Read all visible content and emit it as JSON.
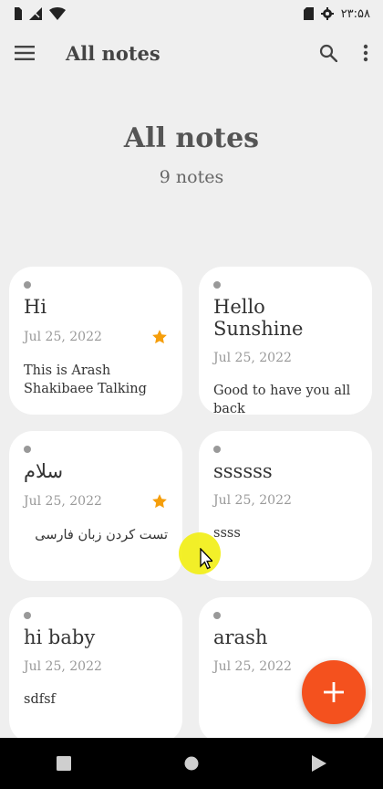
{
  "status_bar": {
    "time": "۲۳:۵۸",
    "left_icons": [
      "sim-icon",
      "no-signal-icon",
      "wifi-icon"
    ],
    "right_icons": [
      "sd-card-icon",
      "settings-icon"
    ]
  },
  "app_bar": {
    "title": "All notes",
    "icons": [
      "menu-icon",
      "search-icon",
      "more-vert-icon"
    ]
  },
  "hero": {
    "title": "All notes",
    "count": "9 notes"
  },
  "notes": [
    {
      "title": "Hi",
      "date": "Jul 25, 2022",
      "body": "This is Arash Shakibaee Talking",
      "starred": true,
      "rtl": false
    },
    {
      "title": "Hello Sunshine",
      "date": "Jul 25, 2022",
      "body": "Good to have you all back",
      "starred": false,
      "rtl": false
    },
    {
      "title": "سلام",
      "date": "Jul 25, 2022",
      "body": "تست کردن زبان فارسی",
      "starred": true,
      "rtl": true
    },
    {
      "title": "ssssss",
      "date": "Jul 25, 2022",
      "body": "ssss",
      "starred": false,
      "rtl": false
    },
    {
      "title": "hi baby",
      "date": "Jul 25, 2022",
      "body": "sdfsf",
      "starred": false,
      "rtl": false
    },
    {
      "title": "arash",
      "date": "Jul 25, 2022",
      "body": "",
      "starred": false,
      "rtl": false
    }
  ],
  "colors": {
    "background": "#efefef",
    "card": "#ffffff",
    "accent_fab": "#f4511e",
    "star": "#f59e0b",
    "nav_bar": "#000000"
  },
  "fab": {
    "icon": "plus-icon"
  },
  "nav_bar": {
    "icons": [
      "recents-icon",
      "home-icon",
      "back-icon"
    ]
  }
}
